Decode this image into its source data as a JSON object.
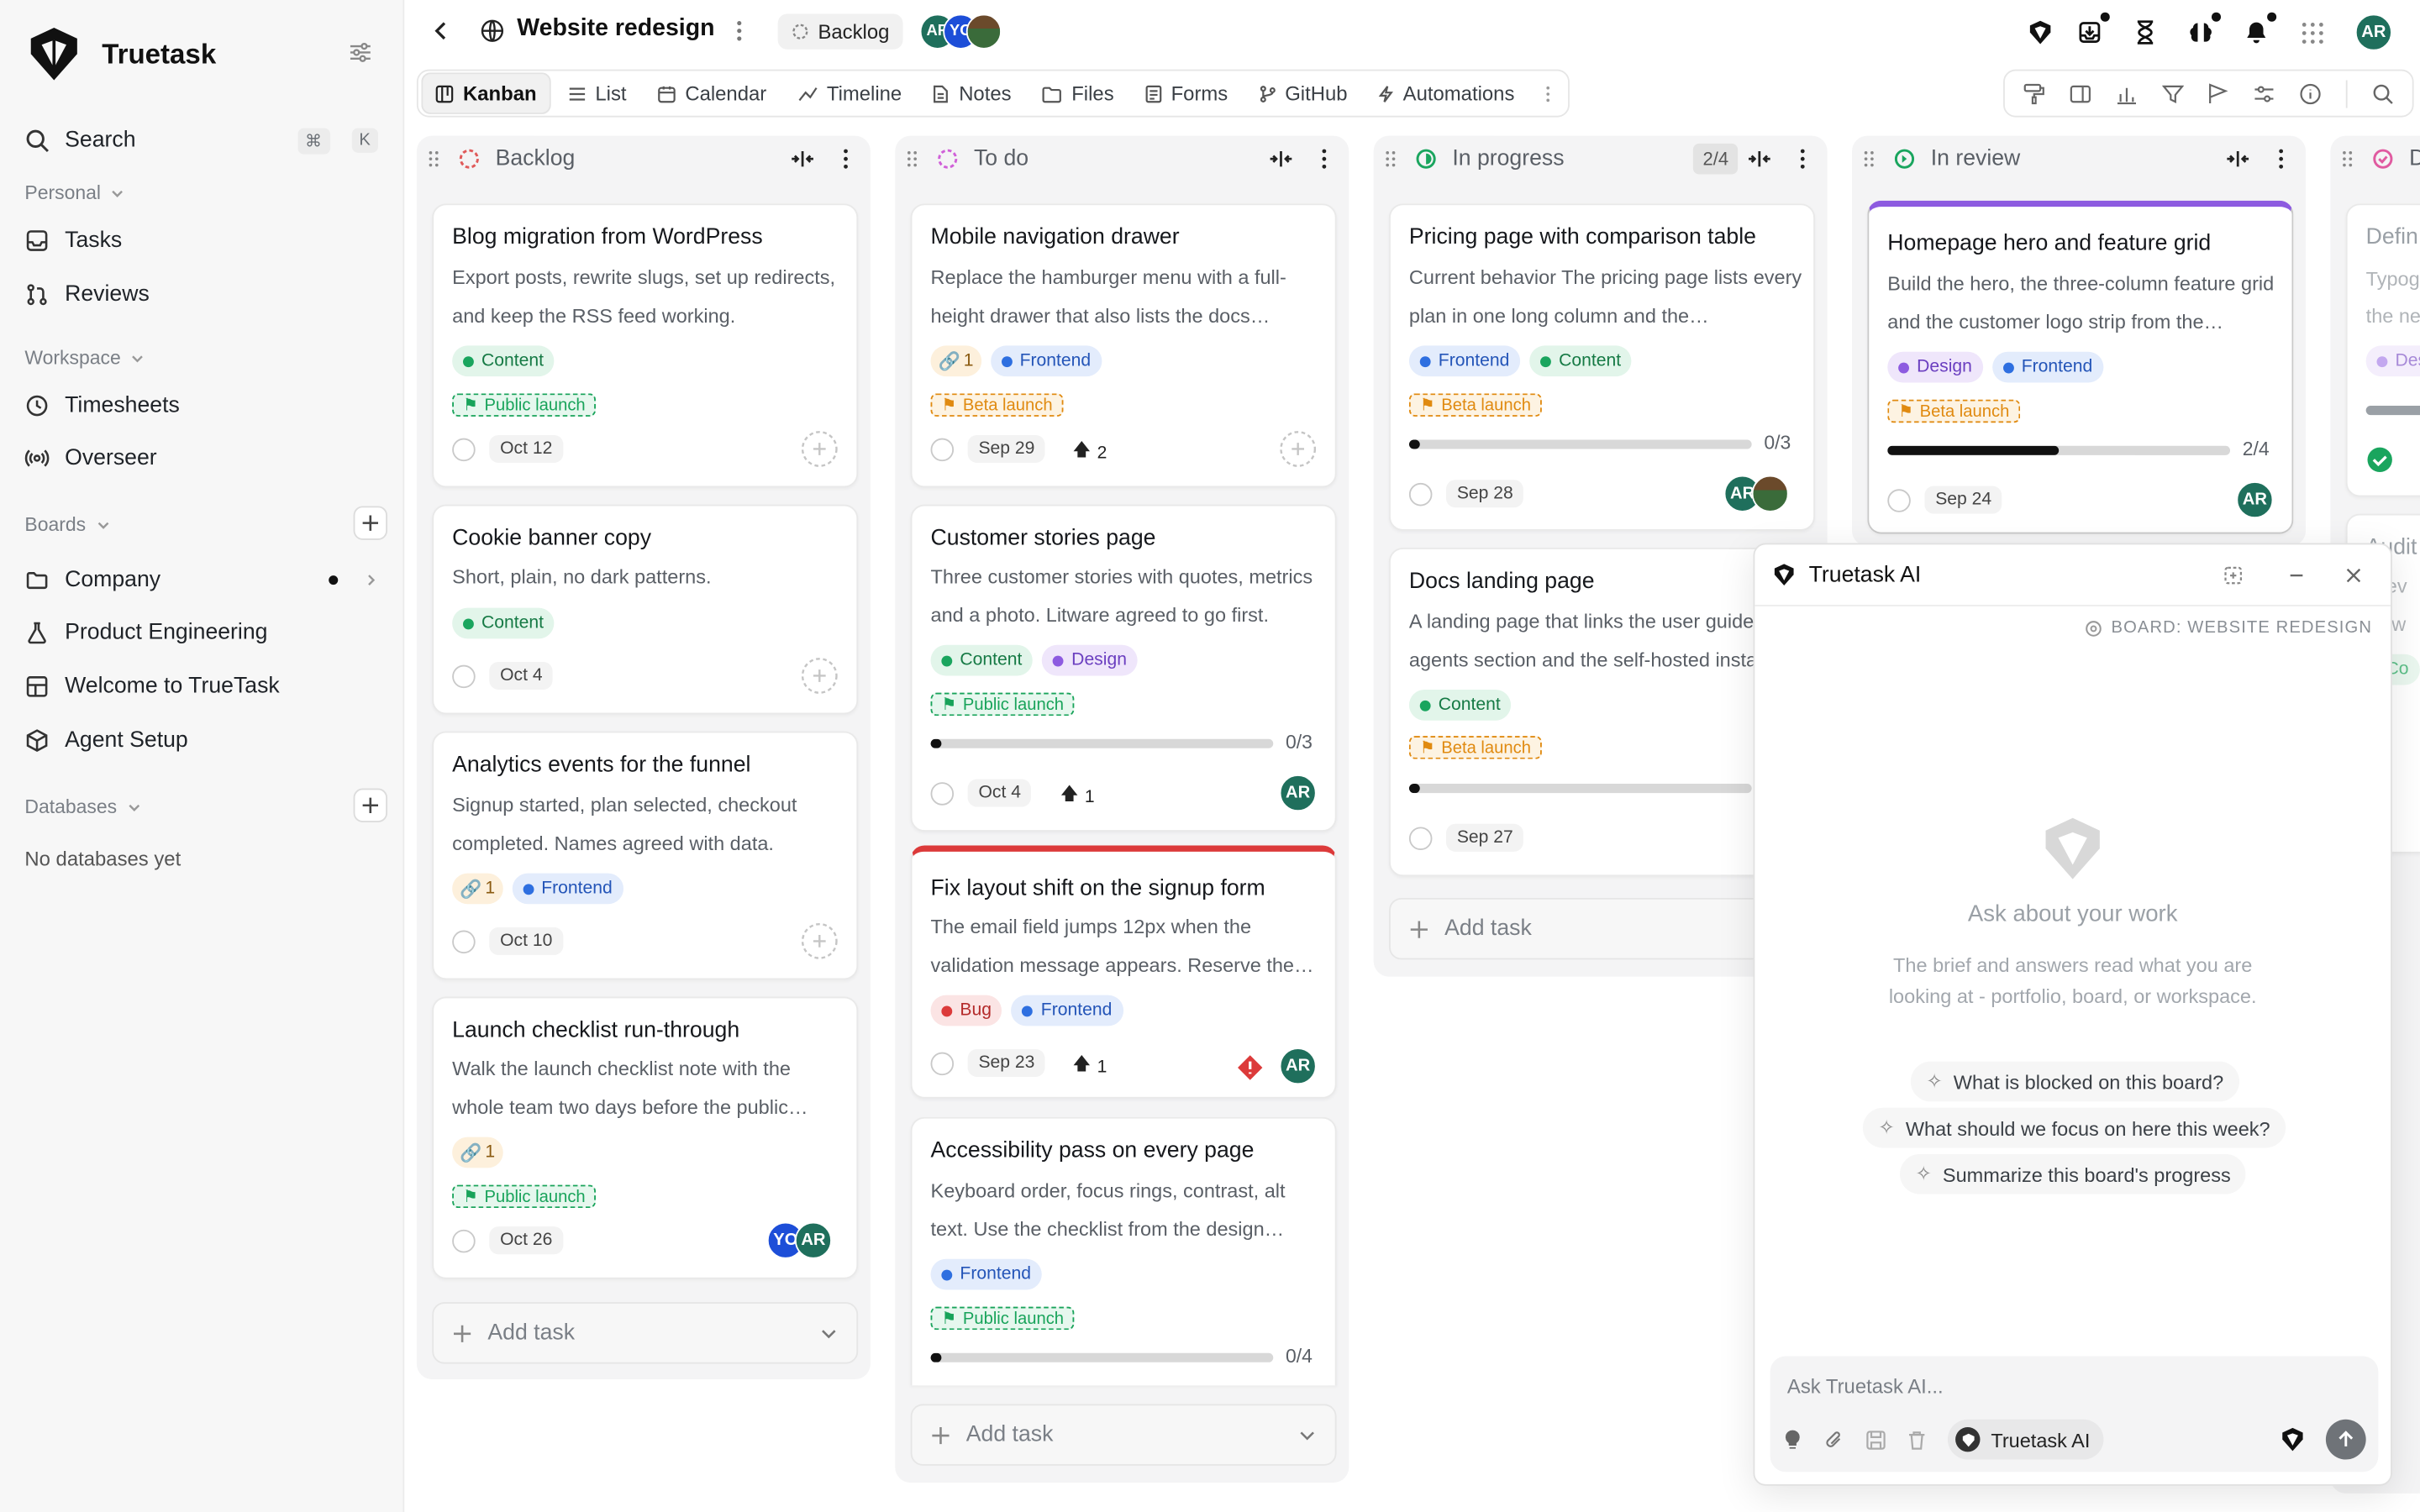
{
  "app": {
    "name": "Truetask"
  },
  "sidebar": {
    "search_label": "Search",
    "search_shortcut_1": "⌘",
    "search_shortcut_2": "K",
    "personal_label": "Personal",
    "personal_items": [
      {
        "label": "Tasks"
      },
      {
        "label": "Reviews"
      }
    ],
    "workspace_label": "Workspace",
    "workspace_items": [
      {
        "label": "Timesheets"
      },
      {
        "label": "Overseer"
      }
    ],
    "boards_label": "Boards",
    "boards": [
      {
        "label": "Company"
      },
      {
        "label": "Product Engineering"
      },
      {
        "label": "Welcome to TrueTask"
      },
      {
        "label": "Agent Setup"
      }
    ],
    "databases_label": "Databases",
    "databases_empty": "No databases yet"
  },
  "header": {
    "title": "Website redesign",
    "status": "Backlog",
    "members": [
      {
        "initials": "AR",
        "color": "#1f6f5c"
      },
      {
        "initials": "YO",
        "color": "#1d4ed8"
      }
    ],
    "user_initials": "AR"
  },
  "tabs": [
    {
      "label": "Kanban"
    },
    {
      "label": "List"
    },
    {
      "label": "Calendar"
    },
    {
      "label": "Timeline"
    },
    {
      "label": "Notes"
    },
    {
      "label": "Files"
    },
    {
      "label": "Forms"
    },
    {
      "label": "GitHub"
    },
    {
      "label": "Automations"
    }
  ],
  "columns": {
    "backlog": {
      "title": "Backlog",
      "add_label": "Add task"
    },
    "todo": {
      "title": "To do",
      "add_label": "Add task"
    },
    "progress": {
      "title": "In progress",
      "count": "2/4",
      "add_label": "Add task"
    },
    "review": {
      "title": "In review"
    },
    "done": {
      "title": "D"
    }
  },
  "cards": {
    "c1": {
      "title": "Blog migration from WordPress",
      "desc": "Export posts, rewrite slugs, set up redirects, and keep the RSS feed working.",
      "tag1": "Content",
      "milestone": "Public launch",
      "date": "Oct 12"
    },
    "c2": {
      "title": "Cookie banner copy",
      "desc": "Short, plain, no dark patterns.",
      "tag1": "Content",
      "date": "Oct 4"
    },
    "c3": {
      "title": "Analytics events for the funnel",
      "desc": "Signup started, plan selected, checkout completed. Names agreed with data.",
      "links": "1",
      "tag1": "Frontend",
      "date": "Oct 10"
    },
    "c4": {
      "title": "Launch checklist run-through",
      "desc": "Walk the launch checklist note with the whole team two days before the public…",
      "links": "1",
      "milestone": "Public launch",
      "date": "Oct 26",
      "a1": "YO",
      "a2": "AR"
    },
    "t1": {
      "title": "Mobile navigation drawer",
      "desc": "Replace the hamburger menu with a full-height drawer that also lists the docs…",
      "links": "1",
      "tag1": "Frontend",
      "milestone": "Beta launch",
      "date": "Sep 29",
      "votes": "2"
    },
    "t2": {
      "title": "Customer stories page",
      "desc": "Three customer stories with quotes, metrics and a photo. Litware agreed to go first.",
      "tag1": "Content",
      "tag2": "Design",
      "milestone": "Public launch",
      "progress": 0.03,
      "progress_label": "0/3",
      "date": "Oct 4",
      "votes": "1",
      "a1": "AR"
    },
    "t3": {
      "title": "Fix layout shift on the signup form",
      "desc": "The email field jumps 12px when the validation message appears. Reserve the…",
      "tag1": "Bug",
      "tag2": "Frontend",
      "date": "Sep 23",
      "votes": "1",
      "a1": "AR"
    },
    "t4": {
      "title": "Accessibility pass on every page",
      "desc": "Keyboard order, focus rings, contrast, alt text. Use the checklist from the design…",
      "tag1": "Frontend",
      "milestone": "Public launch",
      "progress": 0.03,
      "progress_label": "0/4"
    },
    "p1": {
      "title": "Pricing page with comparison table",
      "desc": "Current behavior The pricing page lists every plan in one long column and the…",
      "tag1": "Frontend",
      "tag2": "Content",
      "milestone": "Beta launch",
      "progress": 0.03,
      "progress_label": "0/3",
      "date": "Sep 28",
      "a1": "AR"
    },
    "p2": {
      "title": "Docs landing page",
      "desc": "A landing page that links the user guide, agents section and the self-hosted insta",
      "tag1": "Content",
      "milestone": "Beta launch",
      "progress": 0.03,
      "date": "Sep 27"
    },
    "r1": {
      "title": "Homepage hero and feature grid",
      "desc": "Build the hero, the three-column feature grid and the customer logo strip from the…",
      "tag1": "Design",
      "tag2": "Frontend",
      "milestone": "Beta launch",
      "progress": 0.5,
      "progress_label": "2/4",
      "date": "Sep 24",
      "a1": "AR"
    },
    "d1": {
      "title": "Defin",
      "desc_1": "Typog",
      "desc_2": "the ne",
      "tag1": "Des"
    },
    "d2": {
      "title": "Audit",
      "desc_1": "t ev",
      "desc_2": "d w",
      "tag1": "Co"
    }
  },
  "ai": {
    "title": "Truetask AI",
    "context": "BOARD: WEBSITE REDESIGN",
    "empty_title": "Ask about your work",
    "empty_desc": "The brief and answers read what you are looking at - portfolio, board, or workspace.",
    "suggestions": [
      {
        "label": "What is blocked on this board?"
      },
      {
        "label": "What should we focus on here this week?"
      },
      {
        "label": "Summarize this board's progress"
      }
    ],
    "input_placeholder": "Ask Truetask AI...",
    "model": "Truetask AI"
  },
  "colors": {
    "content": "#1aa55e",
    "frontend": "#2e6fe0",
    "design": "#8d5be0",
    "bug": "#dc3a3a",
    "public": "#18a35a",
    "beta": "#e08a10",
    "avatar_ar": "#1f6f5c",
    "avatar_yo": "#1d4ed8"
  }
}
